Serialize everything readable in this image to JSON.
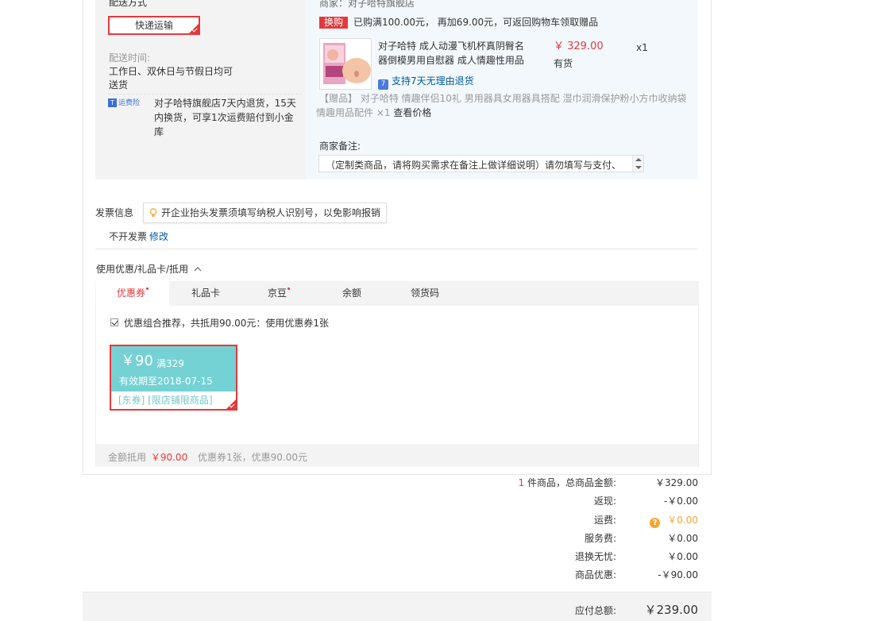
{
  "shipping": {
    "method_label": "配送方式",
    "method_value": "快递运输",
    "time_label": "配送时间:",
    "time_value_1": "工作日、双休日与节假日均可",
    "time_value_2": "送货",
    "insurance_badge": "运费险",
    "insurance_text_1": "对子哈特旗舰店7天内退货，15天",
    "insurance_text_2": "内换货，可享1次运费赔付到小金",
    "insurance_text_3": "库"
  },
  "goods": {
    "merchant": "商家：对子哈特旗舰店",
    "swap_tag": "换购",
    "swap_text": "已购满100.00元， 再加69.00元，可返回购物车领取赠品",
    "product_name_1": "对子哈特 成人动漫飞机杯真阴臀名",
    "product_name_2": "器倒模男用自慰器 成人情趣性用品",
    "price": "￥ 329.00",
    "qty": "x1",
    "stock": "有货",
    "return_icon": "7",
    "return_text": "支持7天无理由退货",
    "gift_tag": "【赠品】",
    "gift_text_1": "对子哈特 情趣伴侣10礼 男用器具女用器具搭配 湿巾润滑保护粉小方巾收纳袋",
    "gift_text_2": "情趣用品配件 ×1",
    "gift_check_price": "查看价格",
    "remark_label": "商家备注:",
    "remark_text": "（定制类商品，请将购买需求在备注上做详细说明）请勿填写与支付、"
  },
  "invoice": {
    "label": "发票信息",
    "tip": "开企业抬头发票须填写纳税人识别号，以免影响报销",
    "value": "不开发票",
    "edit": "修改"
  },
  "coupons": {
    "section_title": "使用优惠/礼品卡/抵用",
    "tabs": [
      "优惠券",
      "礼品卡",
      "京豆",
      "余额",
      "领货码"
    ],
    "recommend_text": "优惠组合推荐，共抵用90.00元：使用优惠券1张",
    "card_amount": "￥90",
    "card_condition": "满329",
    "card_expiry": "有效期至2018-07-15",
    "card_scope": "[东券] [限店铺限商品]",
    "summary_label": "金额抵用",
    "summary_amount": "￥90.00",
    "summary_detail": "优惠券1张，优惠90.00元"
  },
  "totals": {
    "count": "1",
    "goods_label": "件商品，总商品金额:",
    "goods_value": "￥329.00",
    "cashback_label": "返现:",
    "cashback_value": "-￥0.00",
    "freight_label": "运费:",
    "freight_value": "￥0.00",
    "service_label": "服务费:",
    "service_value": "￥0.00",
    "return_label": "退换无忧:",
    "return_value": "￥0.00",
    "discount_label": "商品优惠:",
    "discount_value": "-￥90.00",
    "payable_label": "应付总额:",
    "payable_value": "￥239.00"
  },
  "colors": {
    "accent_red": "#e4393c",
    "link_blue": "#005aa0",
    "coupon_teal": "#74d2d4",
    "freight_orange": "#f7a531"
  }
}
